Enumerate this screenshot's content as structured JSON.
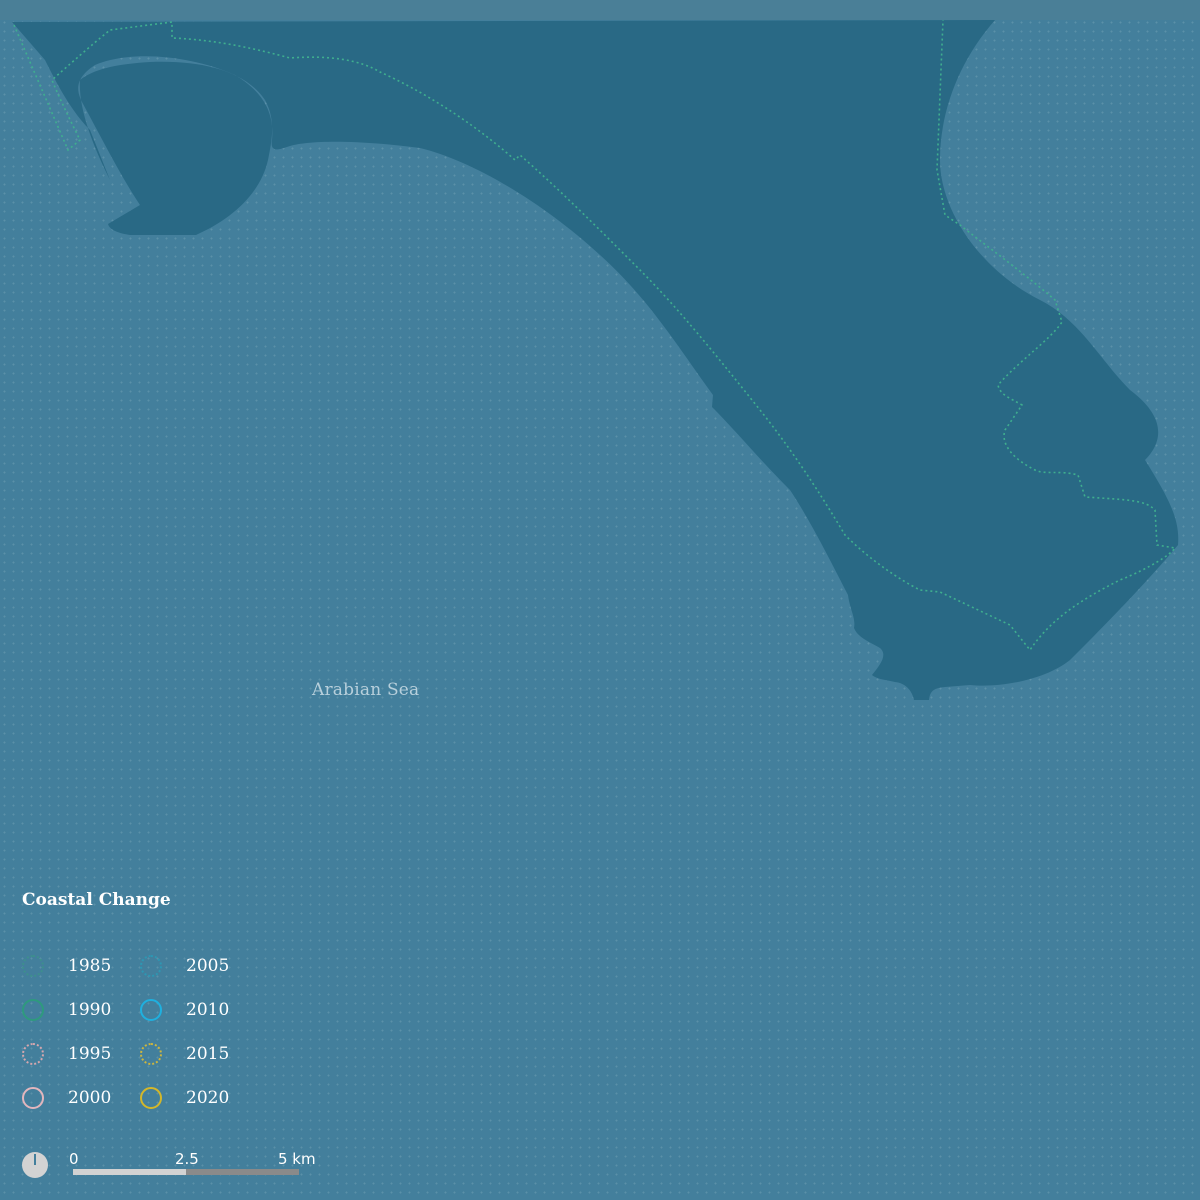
{
  "map": {
    "sea_label": "Arabian Sea",
    "colors": {
      "sea": "#437f9c",
      "land": "#296985",
      "header_strip": "#4a7f97",
      "coastline_1985": "#3fae8f"
    }
  },
  "legend": {
    "title": "Coastal Change",
    "items": [
      {
        "label": "1985",
        "color": "#3d8f8d",
        "style": "dotted"
      },
      {
        "label": "1990",
        "color": "#2e9a7e",
        "style": "solid"
      },
      {
        "label": "1995",
        "color": "#d6a7ae",
        "style": "dotted"
      },
      {
        "label": "2000",
        "color": "#e2b6bd",
        "style": "solid"
      },
      {
        "label": "2005",
        "color": "#2d97b3",
        "style": "dotted"
      },
      {
        "label": "2010",
        "color": "#1fb0df",
        "style": "solid"
      },
      {
        "label": "2015",
        "color": "#cdb63e",
        "style": "dotted"
      },
      {
        "label": "2020",
        "color": "#d3b72a",
        "style": "solid"
      }
    ]
  },
  "scale_bar": {
    "ticks": [
      "0",
      "2.5",
      "5 km"
    ],
    "icon": "north-arrow-icon"
  }
}
